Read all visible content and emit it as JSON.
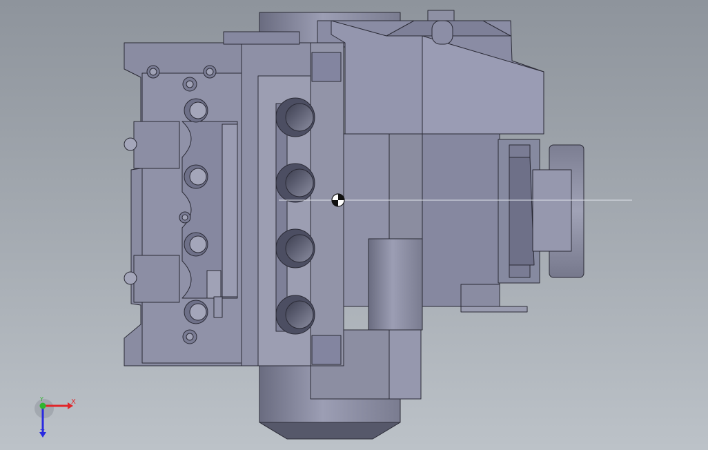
{
  "viewport": {
    "background_top": "#8e949c",
    "background_bottom": "#bcc2c8",
    "model_fill": "#8a8c9e",
    "model_light": "#a2a4b8",
    "model_dark": "#5c5e70",
    "edge_color": "#2a2a35"
  },
  "triad": {
    "x_label": "X",
    "y_label": "Y",
    "z_label": "Z",
    "x_color": "#e0262a",
    "y_color": "#2fb52f",
    "z_color": "#2a2ae0"
  }
}
